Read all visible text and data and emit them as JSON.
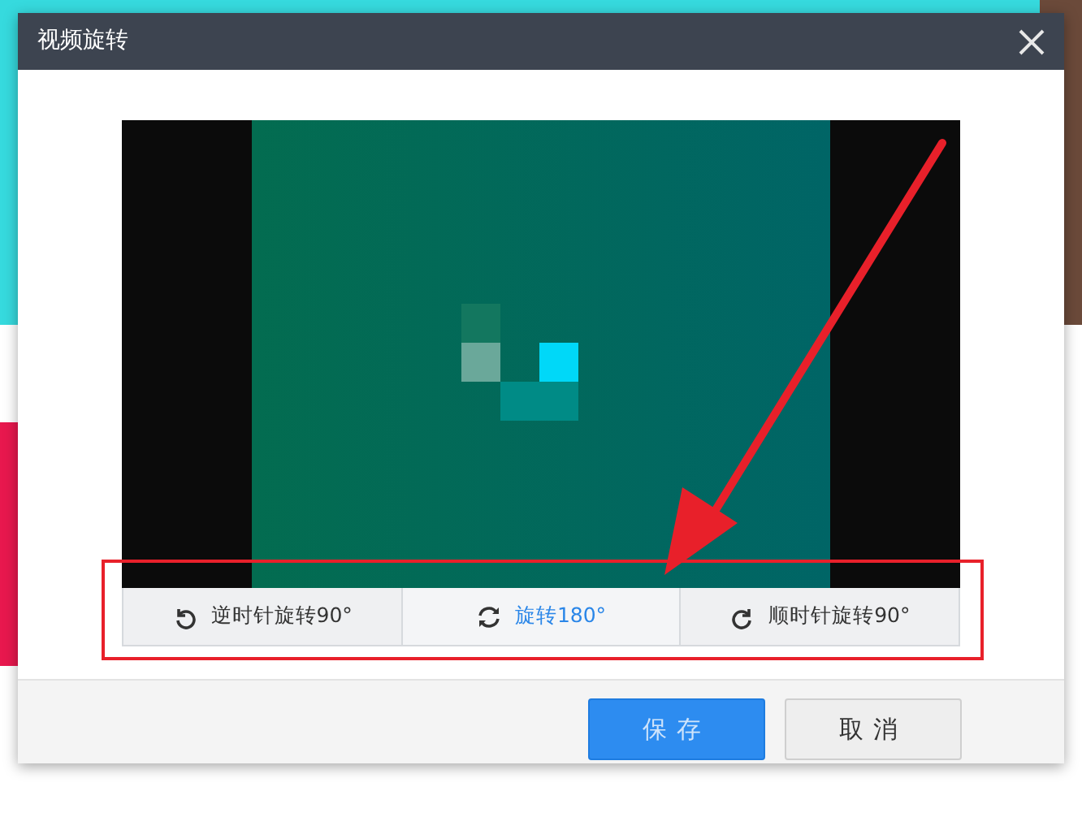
{
  "dialog": {
    "title": "视频旋转",
    "rotate_options": [
      {
        "kind": "ccw",
        "label": "逆时针旋转90°",
        "selected": false
      },
      {
        "kind": "flip",
        "label": "旋转180°",
        "selected": true
      },
      {
        "kind": "cw",
        "label": "顺时针旋转90°",
        "selected": false
      }
    ],
    "buttons": [
      {
        "kind": "primary",
        "label": "保存"
      },
      {
        "kind": "secondary",
        "label": "取消"
      }
    ]
  }
}
